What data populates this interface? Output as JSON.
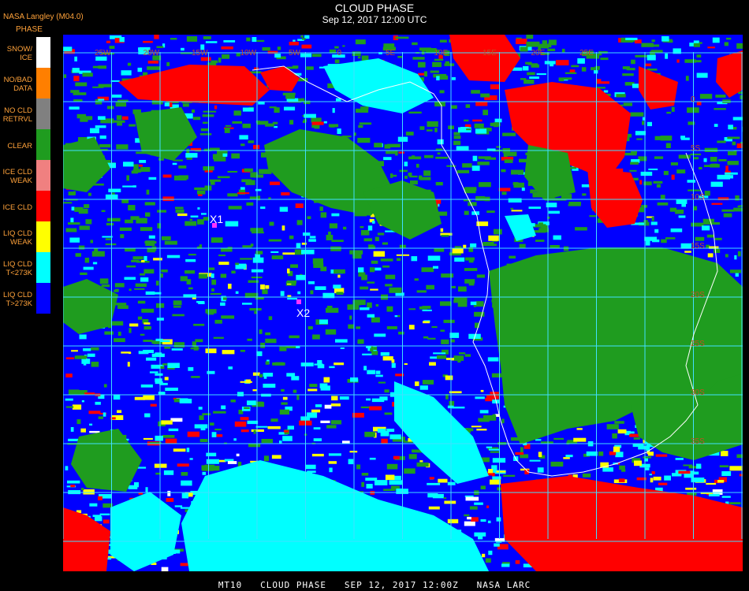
{
  "header": {
    "source": "NASA Langley (M04.0)",
    "legend_title": "PHASE",
    "title": "CLOUD PHASE",
    "subtitle": "Sep 12, 2017 12:00 UTC"
  },
  "legend": [
    {
      "label": "SNOW/\nICE",
      "color": "#ffffff"
    },
    {
      "label": "NO/BAD\nDATA",
      "color": "#ff7f00"
    },
    {
      "label": "NO CLD\nRETRVL",
      "color": "#808080"
    },
    {
      "label": "CLEAR",
      "color": "#1f9c1f"
    },
    {
      "label": "ICE CLD\nWEAK",
      "color": "#f08080"
    },
    {
      "label": "ICE CLD",
      "color": "#ff0000"
    },
    {
      "label": "LIQ CLD\nWEAK",
      "color": "#ffff00"
    },
    {
      "label": "LIQ CLD\nT<273K",
      "color": "#00ffff"
    },
    {
      "label": "LIQ CLD\nT>273K",
      "color": "#0000ff"
    }
  ],
  "map": {
    "markers": [
      {
        "label": "X1"
      },
      {
        "label": "X2"
      }
    ],
    "lon_labels": [
      "25W",
      "20W",
      "15W",
      "10W",
      "5W",
      "0",
      "5E",
      "10E",
      "15E",
      "20E",
      "25E"
    ],
    "lat_labels": [
      "0",
      "5S",
      "10S",
      "15S",
      "20S",
      "25S",
      "30S",
      "35S"
    ],
    "colors": {
      "grid": "#40e0ff",
      "coast": "#ffffff",
      "marker": "#ff33ff",
      "grid_label": "#c05020"
    }
  },
  "footer": "MT10   CLOUD PHASE   SEP 12, 2017 12:00Z   NASA LARC"
}
